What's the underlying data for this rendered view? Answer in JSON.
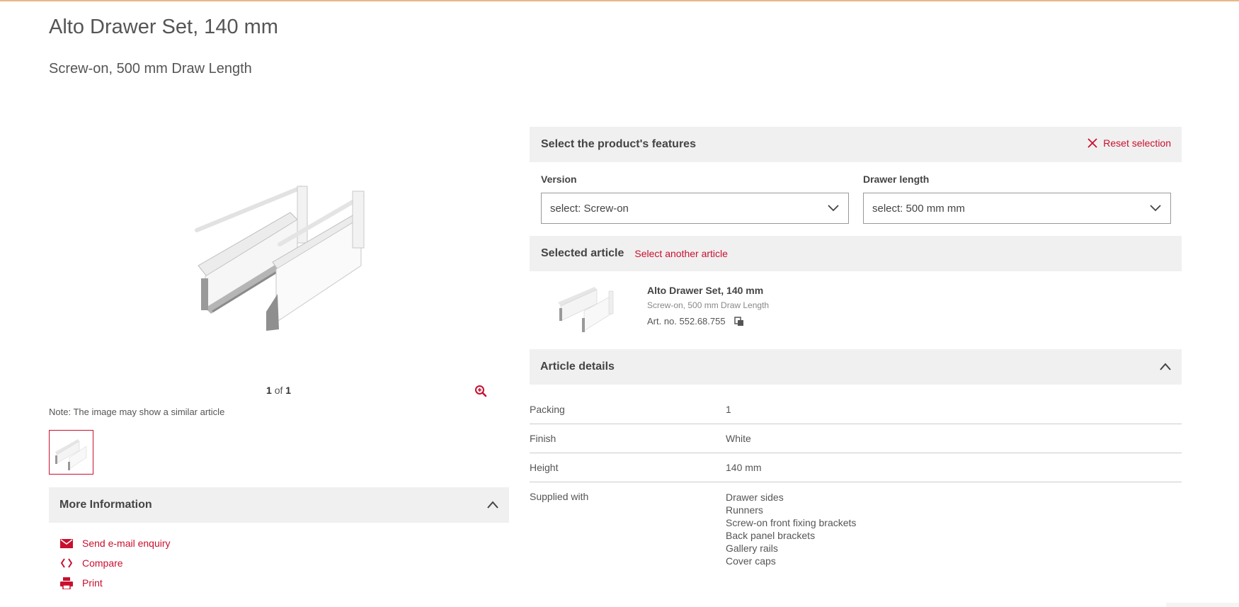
{
  "product": {
    "title": "Alto Drawer Set, 140 mm",
    "subtitle": "Screw-on, 500 mm Draw Length"
  },
  "gallery": {
    "pager_current": "1",
    "pager_of": "of",
    "pager_total": "1",
    "note": "Note: The image may show a similar article"
  },
  "more_info": {
    "title": "More Information",
    "links": [
      {
        "label": "Send e-mail enquiry",
        "icon": "envelope-icon"
      },
      {
        "label": "Compare",
        "icon": "compare-icon"
      },
      {
        "label": "Print",
        "icon": "printer-icon"
      }
    ]
  },
  "features": {
    "title": "Select the product's features",
    "reset_label": "Reset selection",
    "version_label": "Version",
    "version_value": "select: Screw-on",
    "length_label": "Drawer length",
    "length_value": "select: 500 mm mm"
  },
  "selected_article": {
    "title": "Selected article",
    "other_link": "Select another article",
    "name": "Alto Drawer Set, 140 mm",
    "sub": "Screw-on, 500 mm Draw Length",
    "art_no": "Art. no. 552.68.755"
  },
  "article_details": {
    "title": "Article details",
    "rows": [
      {
        "key": "Packing",
        "value": "1"
      },
      {
        "key": "Finish",
        "value": "White"
      },
      {
        "key": "Height",
        "value": "140 mm"
      }
    ],
    "supplied_key": "Supplied with",
    "supplied_items": [
      "Drawer sides",
      "Runners",
      "Screw-on front fixing brackets",
      "Back panel brackets",
      "Gallery rails",
      "Cover caps"
    ]
  },
  "colors": {
    "accent": "#c8102e",
    "panel_bg": "#f0f0f0",
    "top_border": "#e8b887"
  }
}
